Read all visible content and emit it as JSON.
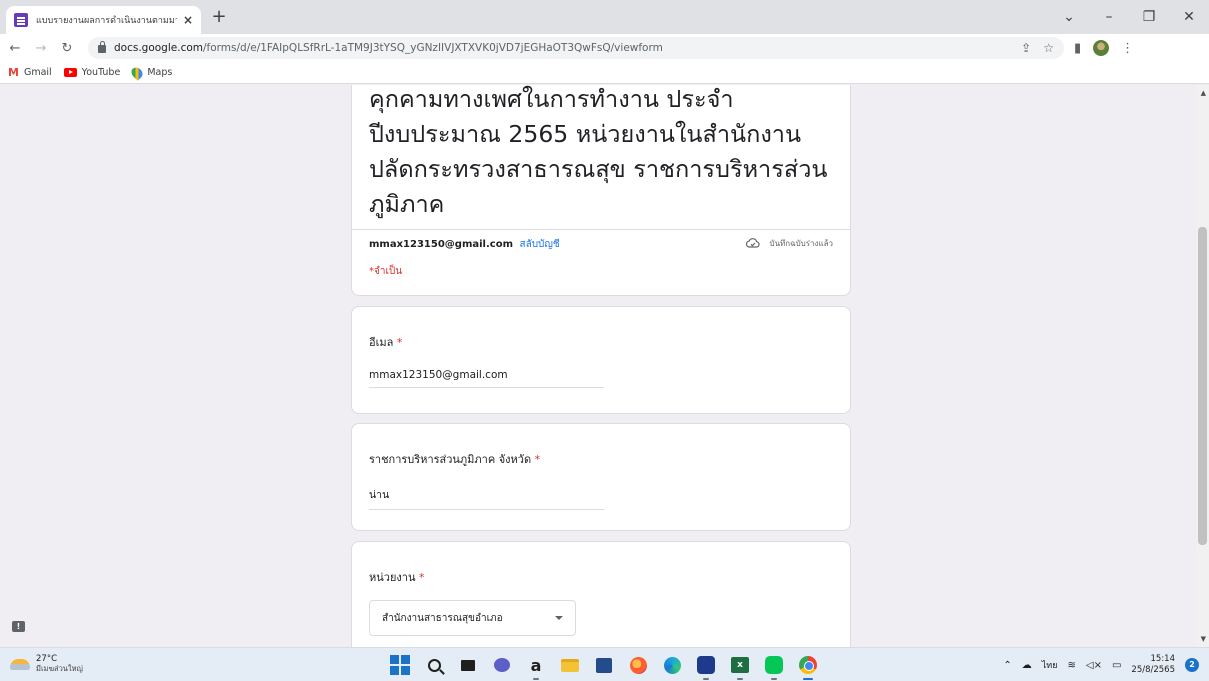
{
  "browser": {
    "tab_title": "แบบรายงานผลการดำเนินงานตามมาตร",
    "tab_close": "×",
    "new_tab": "+",
    "url_domain": "docs.google.com",
    "url_path": "/forms/d/e/1FAIpQLSfRrL-1aTM9J3tYSQ_yGNzIIVJXTXVK0jVD7jEGHaOT3QwFsQ/viewform",
    "bookmarks": [
      {
        "label": "Gmail",
        "icon": "gmail-icon"
      },
      {
        "label": "YouTube",
        "icon": "youtube-icon"
      },
      {
        "label": "Maps",
        "icon": "maps-icon"
      }
    ]
  },
  "form": {
    "title": "คุกคามทางเพศในการทำงาน ประจำปีงบประมาณ 2565 หน่วยงานในสำนักงานปลัดกระทรวงสาธารณสุข  ราชการบริหารส่วนภูมิภาค",
    "title_lines": [
      "คุกคามทางเพศในการทำงาน ประจำ",
      "ปีงบประมาณ 2565 หน่วยงานในสำนักงาน",
      "ปลัดกระทรวงสาธารณสุข  ราชการบริหารส่วน",
      "ภูมิภาค"
    ],
    "account_email": "mmax123150@gmail.com",
    "switch_account": "สลับบัญชี",
    "saved_status": "บันทึกฉบับร่างแล้ว",
    "required_note": "*จำเป็น",
    "questions": [
      {
        "label": "อีเมล",
        "required": "*",
        "answer": "mmax123150@gmail.com"
      },
      {
        "label": "ราชการบริหารส่วนภูมิภาค จังหวัด",
        "required": "*",
        "answer": "น่าน"
      },
      {
        "label": "หน่วยงาน",
        "required": "*",
        "selected": "สำนักงานสาธารณสุขอำเภอ"
      }
    ]
  },
  "taskbar": {
    "weather_temp": "27°C",
    "weather_desc": "มีเมฆส่วนใหญ่",
    "language": "ไทย",
    "time": "15:14",
    "date": "25/8/2565",
    "notification_count": "2"
  },
  "colors": {
    "accent": "#673ab7",
    "link": "#1a73e8",
    "required": "#d93025",
    "page_bg": "#f0eef2"
  }
}
